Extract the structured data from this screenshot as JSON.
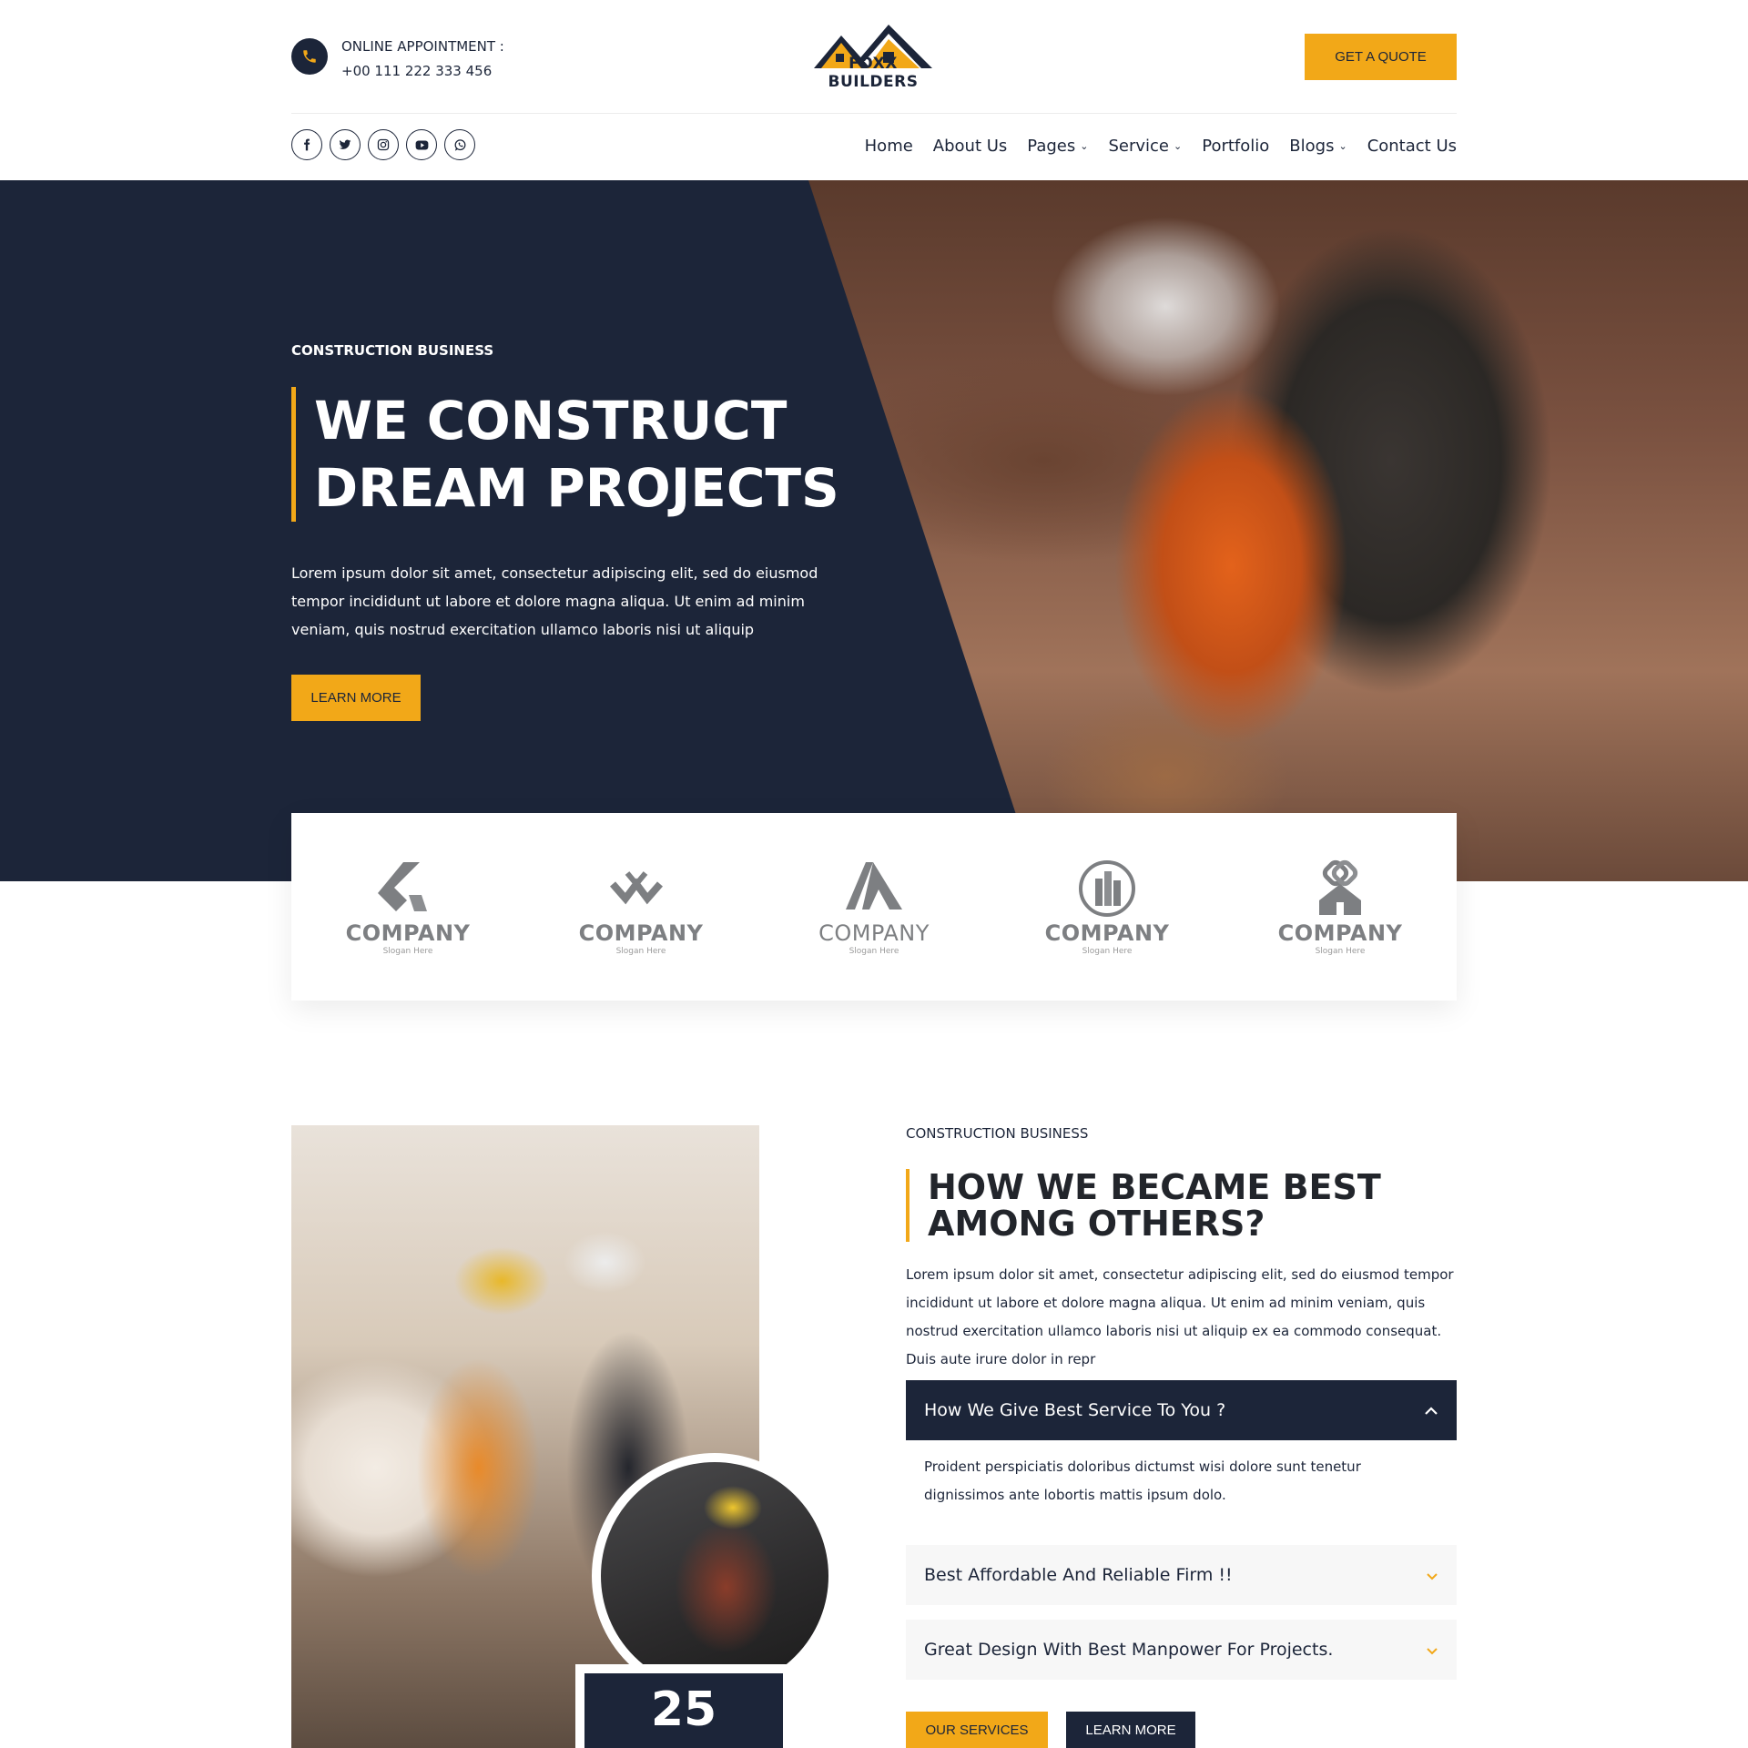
{
  "header": {
    "appointment_label": "ONLINE APPOINTMENT :",
    "phone": "+00 111 222 333 456",
    "logo_text": "FOXX BUILDERS",
    "quote_button": "GET A QUOTE"
  },
  "social_icons": [
    "facebook-icon",
    "twitter-icon",
    "instagram-icon",
    "youtube-icon",
    "whatsapp-icon"
  ],
  "nav": {
    "home": "Home",
    "about": "About Us",
    "pages": "Pages",
    "service": "Service",
    "portfolio": "Portfolio",
    "blogs": "Blogs",
    "contact": "Contact Us"
  },
  "hero": {
    "kicker": "CONSTRUCTION BUSINESS",
    "title_line1": "WE CONSTRUCT",
    "title_line2": "DREAM PROJECTS",
    "description": "Lorem ipsum dolor sit amet, consectetur adipiscing elit, sed do eiusmod tempor incididunt ut labore et dolore magna aliqua. Ut enim ad minim veniam, quis nostrud exercitation ullamco laboris nisi ut aliquip",
    "button": "LEARN MORE"
  },
  "partners": [
    {
      "name": "COMPANY",
      "slogan": "Slogan Here"
    },
    {
      "name": "COMPANY",
      "slogan": "Slogan Here"
    },
    {
      "name": "COMPANY",
      "slogan": "Slogan Here"
    },
    {
      "name": "COMPANY",
      "slogan": "Slogan Here"
    },
    {
      "name": "COMPANY",
      "slogan": "Slogan Here"
    }
  ],
  "about": {
    "kicker": "CONSTRUCTION BUSINESS",
    "title_line1": "HOW WE BECAME BEST",
    "title_line2": "AMONG OTHERS?",
    "description": "Lorem ipsum dolor sit amet, consectetur adipiscing elit, sed do eiusmod tempor incididunt ut labore et dolore magna aliqua. Ut enim ad minim veniam, quis nostrud exercitation ullamco laboris nisi ut aliquip ex ea commodo consequat. Duis aute irure dolor in repr",
    "counter": "25",
    "accordion": [
      {
        "title": "How We Give Best Service To You ?",
        "body": "Proident perspiciatis doloribus dictumst wisi dolore sunt tenetur dignissimos ante lobortis mattis ipsum dolo."
      },
      {
        "title": "Best Affordable And Reliable Firm !!"
      },
      {
        "title": "Great Design With Best Manpower For Projects."
      }
    ],
    "services_button": "OUR SERVICES",
    "learn_button": "LEARN MORE"
  },
  "colors": {
    "navy": "#1c2539",
    "accent": "#f2a818"
  }
}
